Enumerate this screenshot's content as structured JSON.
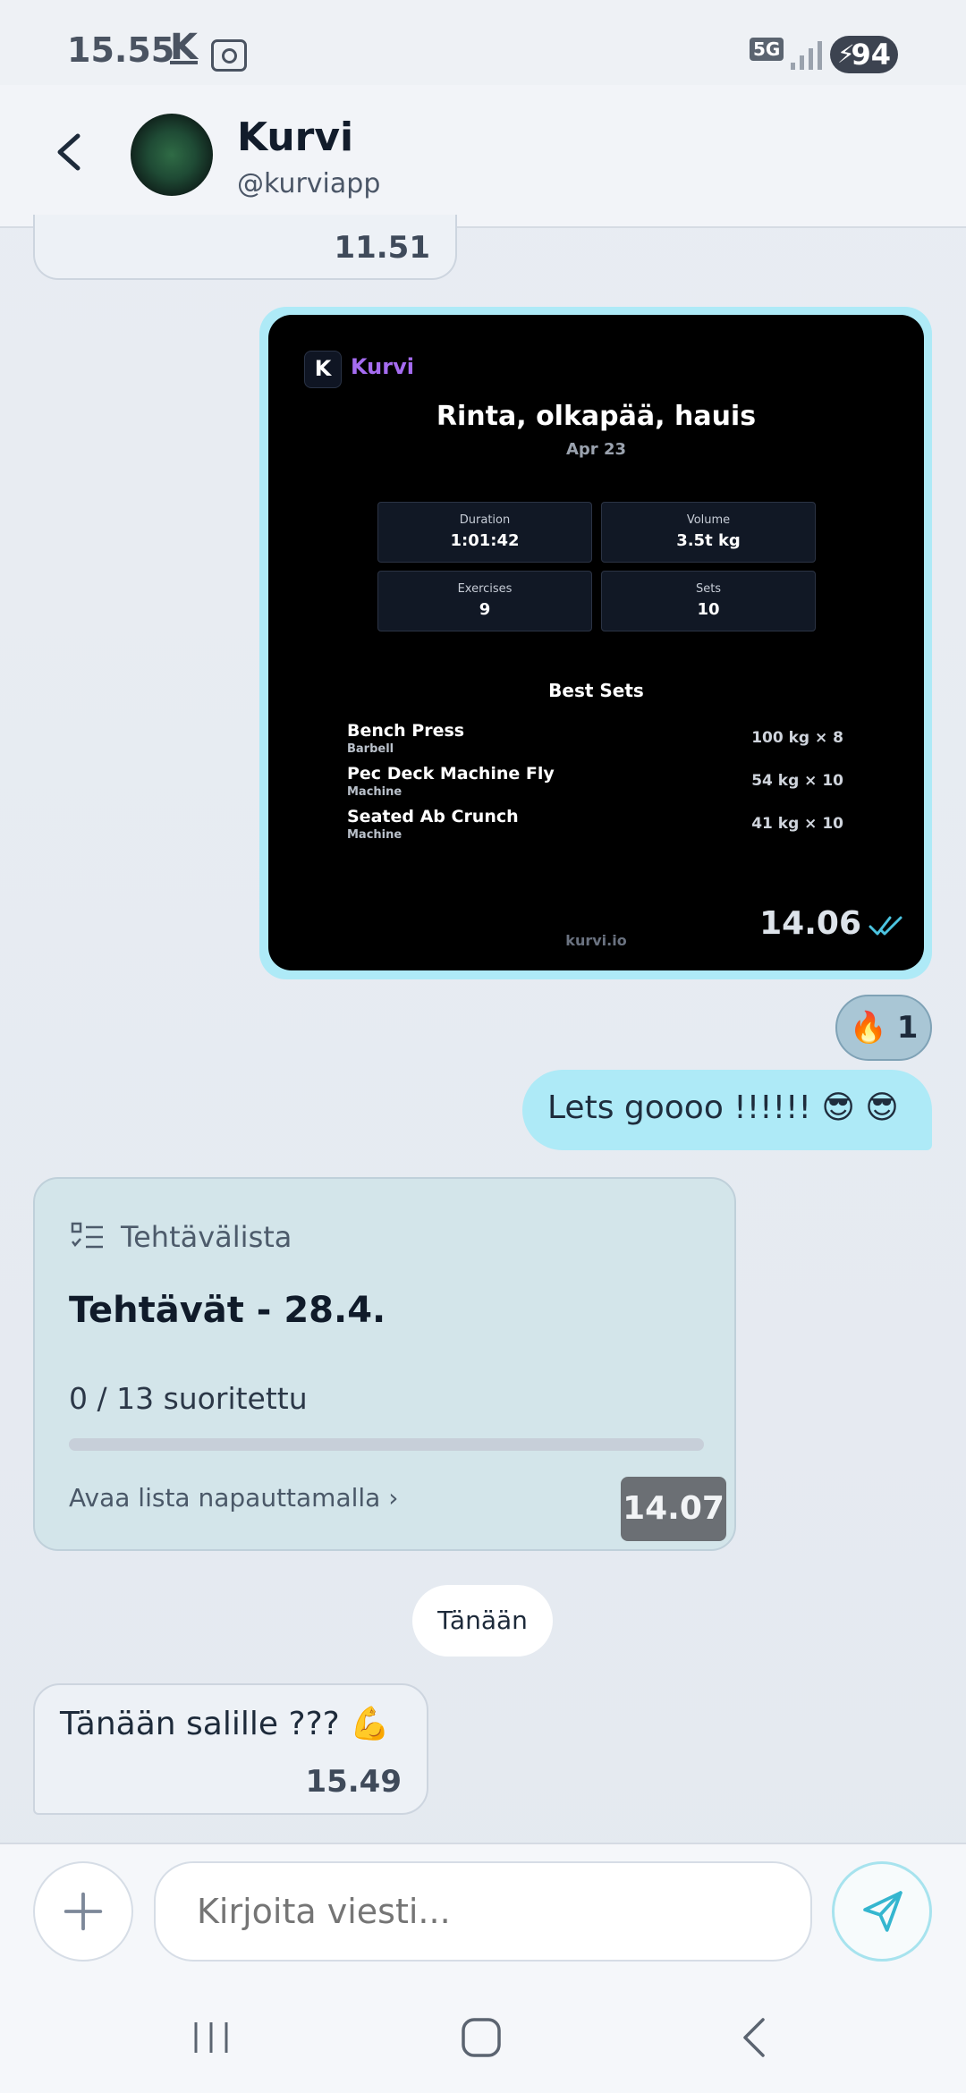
{
  "status_bar": {
    "time": "15.55",
    "app_k": "K",
    "network": "5G",
    "battery": "94"
  },
  "header": {
    "name": "Kurvi",
    "handle": "@kurviapp"
  },
  "messages": {
    "old": {
      "time": "11.51"
    },
    "image": {
      "brand": "Kurvi",
      "logo_letter": "K",
      "title": "Rinta, olkapää, hauis",
      "date": "Apr 23",
      "stats": [
        {
          "label": "Duration",
          "value": "1:01:42"
        },
        {
          "label": "Volume",
          "value": "3.5t kg"
        },
        {
          "label": "Exercises",
          "value": "9"
        },
        {
          "label": "Sets",
          "value": "10"
        }
      ],
      "best_title": "Best Sets",
      "best_sets": [
        {
          "name": "Bench Press",
          "type": "Barbell",
          "value": "100 kg × 8"
        },
        {
          "name": "Pec Deck Machine Fly",
          "type": "Machine",
          "value": "54 kg × 10"
        },
        {
          "name": "Seated Ab Crunch",
          "type": "Machine",
          "value": "41 kg × 10"
        }
      ],
      "footer": "kurvi.io",
      "time": "14.06"
    },
    "reaction": {
      "emoji": "🔥",
      "count": "1"
    },
    "lets": {
      "text": "Lets goooo !!!!!!  😎 😎"
    },
    "task": {
      "kind": "Tehtävälista",
      "title": "Tehtävät - 28.4.",
      "progress_text": "0 / 13 suoritettu",
      "progress_fraction": 0,
      "link": "Avaa lista napauttamalla  ›",
      "time": "14.07"
    },
    "date_divider": "Tänään",
    "last": {
      "text": "Tänään salille ??? 💪",
      "time": "15.49"
    }
  },
  "composer": {
    "placeholder": "Kirjoita viesti..."
  },
  "colors": {
    "accent": "#aeeaf7",
    "brand_purple": "#a56cf0",
    "progress": "#2fb2cf"
  }
}
